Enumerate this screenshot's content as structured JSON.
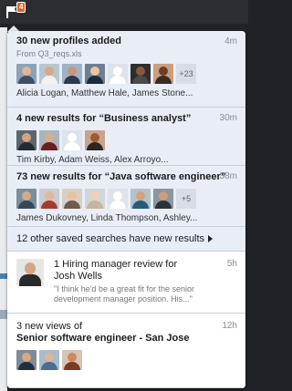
{
  "header": {
    "badge_count": "4"
  },
  "notifications": [
    {
      "title": "30 new profiles added",
      "time": "4m",
      "subtitle": "From Q3_reqs.xls",
      "more": "+23",
      "names": "Alicia Logan, Matthew Hale, James Stone..."
    },
    {
      "title": "4 new results for “Business analyst”",
      "time": "30m",
      "names": "Tim Kirby, Adam Weiss, Alex Arroyo..."
    },
    {
      "title": "73 new results for “Java software engineer”",
      "time": "38m",
      "more": "+5",
      "names": "James Dukovney, Linda Thompson, Ashley..."
    },
    {
      "title": "12 other saved searches have new results"
    },
    {
      "title_line1": "1 Hiring manager review for",
      "title_line2": "Josh Wells",
      "time": "5h",
      "quote": "\"I think he'd be a great fit for the senior development manager position. His...\""
    },
    {
      "title_line1": "3 new views of",
      "title_line2": "Senior software engineer - San Jose",
      "time": "12h"
    }
  ],
  "colors": {
    "accent_badge": "#e0661f",
    "unread_bg": "#e8edf6",
    "read_bg": "#ffffff"
  }
}
